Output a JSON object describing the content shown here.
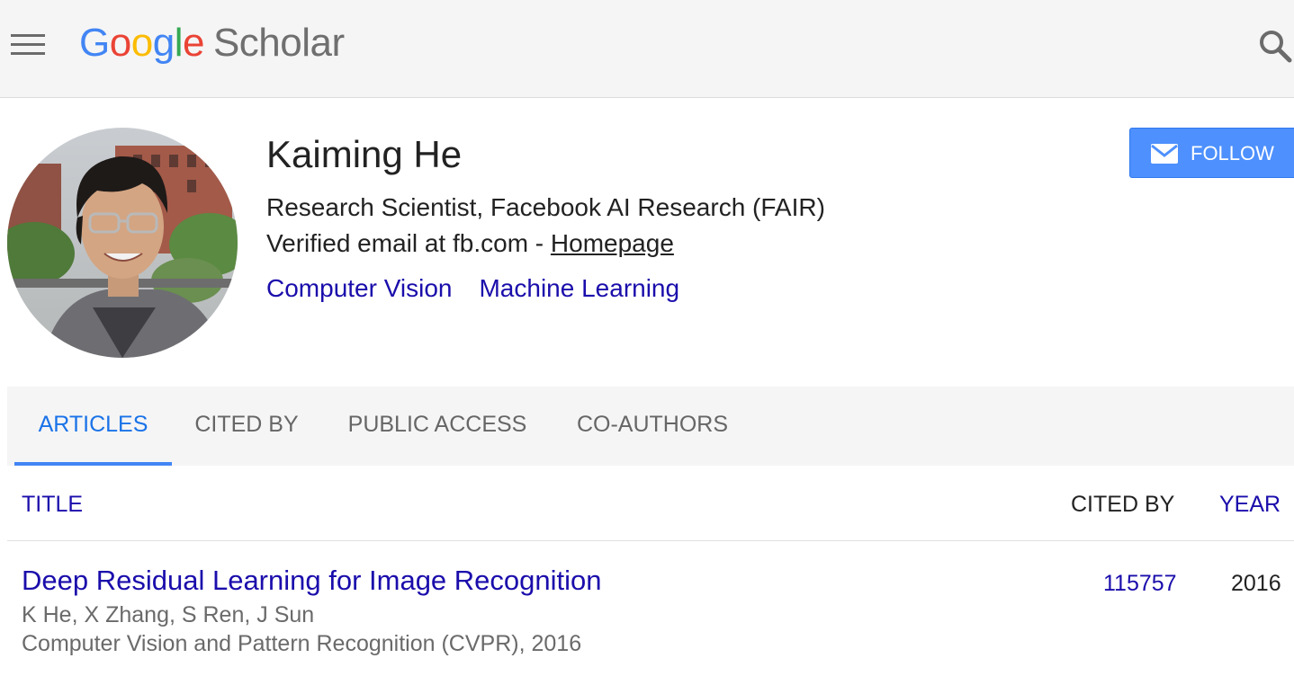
{
  "header": {
    "logo": {
      "letters": [
        "G",
        "o",
        "o",
        "g",
        "l",
        "e"
      ],
      "scholar": "Scholar"
    },
    "menu_icon": "hamburger-menu-icon",
    "search_icon": "search-icon"
  },
  "profile": {
    "name": "Kaiming He",
    "affiliation": "Research Scientist, Facebook AI Research (FAIR)",
    "email_text": "Verified email at fb.com - ",
    "homepage_link": "Homepage",
    "interests": [
      "Computer Vision",
      "Machine Learning"
    ],
    "follow_label": "FOLLOW",
    "follow_icon": "mail-icon"
  },
  "tabs": [
    {
      "label": "ARTICLES",
      "active": true
    },
    {
      "label": "CITED BY",
      "active": false
    },
    {
      "label": "PUBLIC ACCESS",
      "active": false
    },
    {
      "label": "CO-AUTHORS",
      "active": false
    }
  ],
  "table": {
    "headers": {
      "title": "TITLE",
      "cited_by": "CITED BY",
      "year": "YEAR"
    },
    "rows": [
      {
        "title": "Deep Residual Learning for Image Recognition",
        "authors": "K He, X Zhang, S Ren, J Sun",
        "venue": "Computer Vision and Pattern Recognition (CVPR), 2016",
        "cited_by": "115757",
        "year": "2016"
      }
    ]
  },
  "colors": {
    "link": "#1a0dab",
    "accent": "#4285f4",
    "follow_button": "#4d90fe",
    "header_bg": "#f5f5f5"
  }
}
